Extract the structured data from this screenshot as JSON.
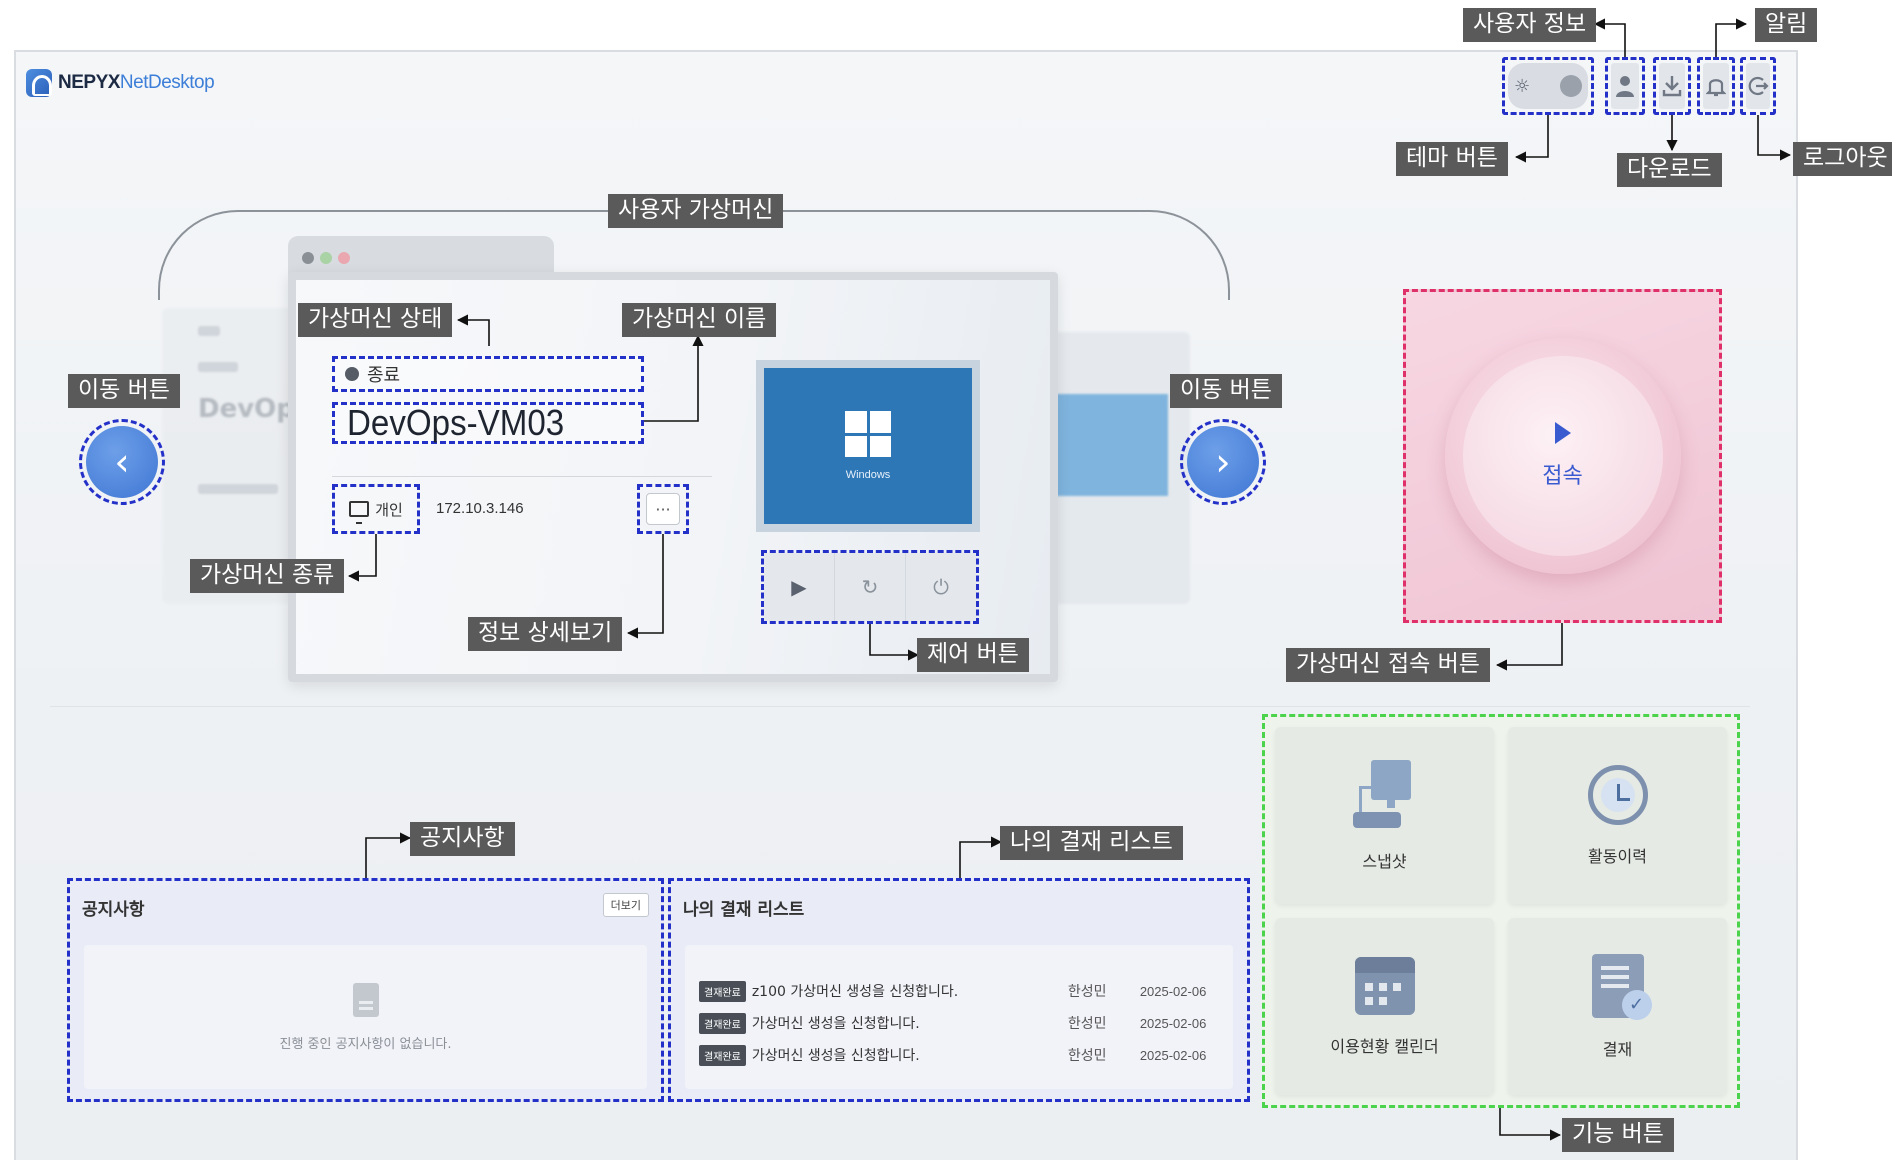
{
  "brand": {
    "name": "NEPYX",
    "accent": "NetDesktop"
  },
  "callouts": {
    "user_info": "사용자 정보",
    "alarm": "알림",
    "theme_button": "테마 버튼",
    "download": "다운로드",
    "logout": "로그아웃",
    "user_vm": "사용자 가상머신",
    "vm_status": "가상머신 상태",
    "vm_name": "가상머신 이름",
    "nav_left": "이동 버튼",
    "nav_right": "이동 버튼",
    "vm_type": "가상머신 종류",
    "detail_view": "정보 상세보기",
    "control_buttons": "제어 버튼",
    "vm_connect_button": "가상머신 접속 버튼",
    "notice": "공지사항",
    "my_approval_list": "나의 결재 리스트",
    "function_buttons": "기능 버튼"
  },
  "vm_card": {
    "status": "종료",
    "name": "DevOps-VM03",
    "type": "개인",
    "ip": "172.10.3.146",
    "more": "···",
    "os": "Windows",
    "ghost_name": "DevOps-V"
  },
  "connect": {
    "label": "접속"
  },
  "notice_panel": {
    "title": "공지사항",
    "more": "더보기",
    "empty": "진행 중인 공지사항이 없습니다."
  },
  "approval_panel": {
    "title": "나의 결재 리스트",
    "rows": [
      {
        "badge": "결재완료",
        "title": "z100 가상머신 생성을 신청합니다.",
        "user": "한성민",
        "date": "2025-02-06"
      },
      {
        "badge": "결재완료",
        "title": "가상머신 생성을 신청합니다.",
        "user": "한성민",
        "date": "2025-02-06"
      },
      {
        "badge": "결재완료",
        "title": "가상머신 생성을 신청합니다.",
        "user": "한성민",
        "date": "2025-02-06"
      }
    ]
  },
  "functions": [
    {
      "label": "스냅샷",
      "icon": "snapshot-icon"
    },
    {
      "label": "활동이력",
      "icon": "history-icon"
    },
    {
      "label": "이용현황 캘린더",
      "icon": "calendar-icon"
    },
    {
      "label": "결재",
      "icon": "approval-icon"
    }
  ],
  "colors": {
    "annotation_blue": "#2431c9",
    "annotation_pink": "#e0306a",
    "annotation_green": "#4cd34c",
    "callout_bg": "#5a5a5a"
  }
}
